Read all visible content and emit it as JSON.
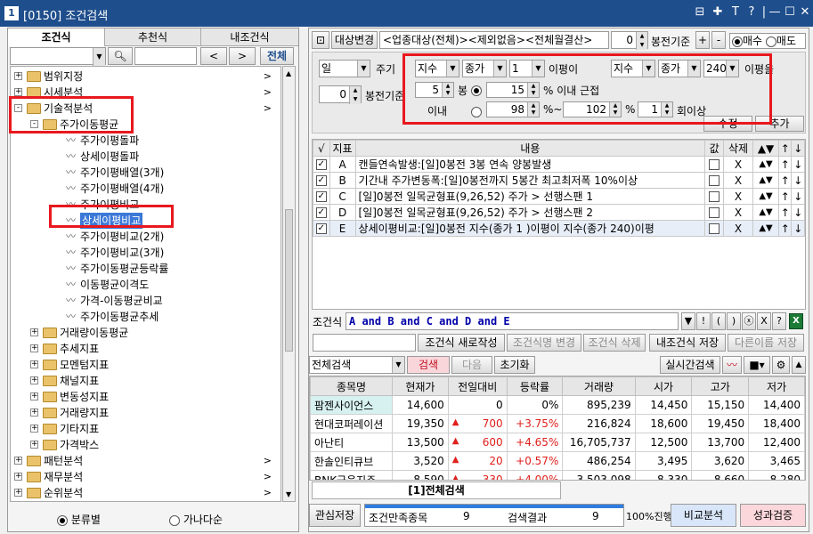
{
  "window": {
    "id": "1",
    "title": "[0150] 조건검색",
    "controls": [
      "⊟",
      "✚",
      "T",
      "?",
      "|",
      "—",
      "☐",
      "✕"
    ]
  },
  "left": {
    "tabs": [
      "조건식",
      "추천식",
      "내조건식"
    ],
    "nav": {
      "prev": "<",
      "next": ">",
      "all": "전체"
    },
    "tree": [
      {
        "label": "범위지정",
        "type": "folder",
        "expand": "+",
        "level": 0,
        "chev": ">"
      },
      {
        "label": "시세분석",
        "type": "folder",
        "expand": "+",
        "level": 0,
        "chev": ">"
      },
      {
        "label": "기술적분석",
        "type": "folder",
        "expand": "-",
        "level": 0,
        "chev": ">"
      },
      {
        "label": "주가이동평균",
        "type": "folder",
        "expand": "-",
        "level": 1,
        "chev": ""
      },
      {
        "label": "주가이평돌파",
        "type": "item",
        "level": 2
      },
      {
        "label": "상세이평돌파",
        "type": "item",
        "level": 2
      },
      {
        "label": "주가이평배열(3개)",
        "type": "item",
        "level": 2
      },
      {
        "label": "주가이평배열(4개)",
        "type": "item",
        "level": 2
      },
      {
        "label": "주가이평비교",
        "type": "item",
        "level": 2
      },
      {
        "label": "상세이평비교",
        "type": "item",
        "level": 2,
        "selected": true
      },
      {
        "label": "주가이평비교(2개)",
        "type": "item",
        "level": 2
      },
      {
        "label": "주가이평비교(3개)",
        "type": "item",
        "level": 2
      },
      {
        "label": "주가이동평균등락률",
        "type": "item",
        "level": 2
      },
      {
        "label": "이동평균이격도",
        "type": "item",
        "level": 2
      },
      {
        "label": "가격-이동평균비교",
        "type": "item",
        "level": 2
      },
      {
        "label": "주가이동평균추세",
        "type": "item",
        "level": 2
      },
      {
        "label": "거래량이동평균",
        "type": "folder",
        "expand": "+",
        "level": 1
      },
      {
        "label": "추세지표",
        "type": "folder",
        "expand": "+",
        "level": 1
      },
      {
        "label": "모멘텀지표",
        "type": "folder",
        "expand": "+",
        "level": 1
      },
      {
        "label": "채널지표",
        "type": "folder",
        "expand": "+",
        "level": 1
      },
      {
        "label": "변동성지표",
        "type": "folder",
        "expand": "+",
        "level": 1
      },
      {
        "label": "거래량지표",
        "type": "folder",
        "expand": "+",
        "level": 1
      },
      {
        "label": "기타지표",
        "type": "folder",
        "expand": "+",
        "level": 1
      },
      {
        "label": "가격박스",
        "type": "folder",
        "expand": "+",
        "level": 1
      },
      {
        "label": "패턴분석",
        "type": "folder",
        "expand": "+",
        "level": 0,
        "chev": ">"
      },
      {
        "label": "재무분석",
        "type": "folder",
        "expand": "+",
        "level": 0,
        "chev": ">"
      },
      {
        "label": "순위분석",
        "type": "folder",
        "expand": "+",
        "level": 0,
        "chev": ">"
      }
    ],
    "sort_options": [
      {
        "label": "분류별",
        "checked": true
      },
      {
        "label": "가나다순",
        "checked": false
      }
    ]
  },
  "top": {
    "target_btn": "대상변경",
    "target_text": "<업종대상(전체)><제외없음><전체월결산>",
    "bar_value": "0",
    "bar_label": "봉전기준",
    "plus": "+",
    "minus": "-",
    "buy": "매수",
    "sell": "매도"
  },
  "cond": {
    "period": "일",
    "period_label": "주기",
    "bar_value": "0",
    "bar_label": "봉전기준",
    "s1": "지수",
    "s2": "종가",
    "s3": "1",
    "ma_label1": "이평이",
    "s4": "지수",
    "s5": "종가",
    "s6": "240",
    "ma_label2": "이평을",
    "bars": "5",
    "bars_label": "봉",
    "within_val": "15",
    "within_label": "% 이내 근접",
    "range_label": "이내",
    "r_from": "98",
    "r_mid": "%~",
    "r_to": "102",
    "r_pct": "%",
    "times": "1",
    "times_label": "회이상",
    "edit_btn": "수정",
    "add_btn": "추가"
  },
  "conditions": {
    "headers": [
      "√",
      "지표",
      "내용",
      "값",
      "삭제",
      "▲▼",
      "↑",
      "↓"
    ],
    "rows": [
      {
        "check": true,
        "id": "A",
        "text": "캔들연속발생:[일]0봉전 3봉 연속 양봉발생",
        "del": "X"
      },
      {
        "check": true,
        "id": "B",
        "text": "기간내 주가변동폭:[일]0봉전까지 5봉간 최고최저폭 10%이상",
        "del": "X"
      },
      {
        "check": true,
        "id": "C",
        "text": "[일]0봉전 일목균형표(9,26,52) 주가 > 선행스팬 1",
        "del": "X"
      },
      {
        "check": true,
        "id": "D",
        "text": "[일]0봉전 일목균형표(9,26,52) 주가 > 선행스팬 2",
        "del": "X"
      },
      {
        "check": true,
        "id": "E",
        "text": "상세이평비교:[일]0봉전 지수(종가 1 )이평이 지수(종가 240)이평",
        "del": "X",
        "selected": true
      }
    ]
  },
  "expr": {
    "label": "조건식",
    "value": "A and B and C and D and E",
    "ops": [
      "▼",
      "!",
      "(",
      ")",
      "ⓧ",
      "X",
      "?"
    ]
  },
  "actions": {
    "new": "조건식 새로작성",
    "change": "조건식명 변경",
    "delete": "조건식 삭제",
    "save": "내조건식 저장",
    "save_as": "다른이름 저장"
  },
  "search": {
    "mode": "전체검색",
    "search": "검색",
    "next": "다음",
    "reset": "초기화",
    "realtime": "실시간검색"
  },
  "results": {
    "headers": [
      "종목명",
      "현재가",
      "전일대비",
      "등락률",
      "거래량",
      "시가",
      "고가",
      "저가"
    ],
    "rows": [
      {
        "name": "팜젠사이언스",
        "price": "14,600",
        "chg": "0",
        "rate": "0%",
        "vol": "895,239",
        "open": "14,450",
        "high": "15,150",
        "low": "14,400",
        "up": false,
        "hl": true
      },
      {
        "name": "현대코퍼레이션",
        "price": "19,350",
        "chg": "700",
        "rate": "+3.75%",
        "vol": "216,824",
        "open": "18,600",
        "high": "19,450",
        "low": "18,400",
        "up": true
      },
      {
        "name": "아난티",
        "price": "13,500",
        "chg": "600",
        "rate": "+4.65%",
        "vol": "16,705,737",
        "open": "12,500",
        "high": "13,700",
        "low": "12,400",
        "up": true
      },
      {
        "name": "한솔인티큐브",
        "price": "3,520",
        "chg": "20",
        "rate": "+0.57%",
        "vol": "486,254",
        "open": "3,495",
        "high": "3,620",
        "low": "3,465",
        "up": true
      },
      {
        "name": "BNK금융지주",
        "price": "8,590",
        "chg": "330",
        "rate": "+4.00%",
        "vol": "3,503,098",
        "open": "8,330",
        "high": "8,660",
        "low": "8,280",
        "up": true
      }
    ]
  },
  "bottom": {
    "tab": "[1]전체검색",
    "watch": "관심저장",
    "match_label": "조건만족종목",
    "match_count": "9",
    "result_label": "검색결과",
    "result_count": "9",
    "progress": "100%진행",
    "compare": "비교분석",
    "verify": "성과검증"
  },
  "colors": {
    "titlebar": "#1f4e8c",
    "highlight": "#e8181e",
    "up": "#e0201c",
    "selected": "#3b78d8"
  }
}
